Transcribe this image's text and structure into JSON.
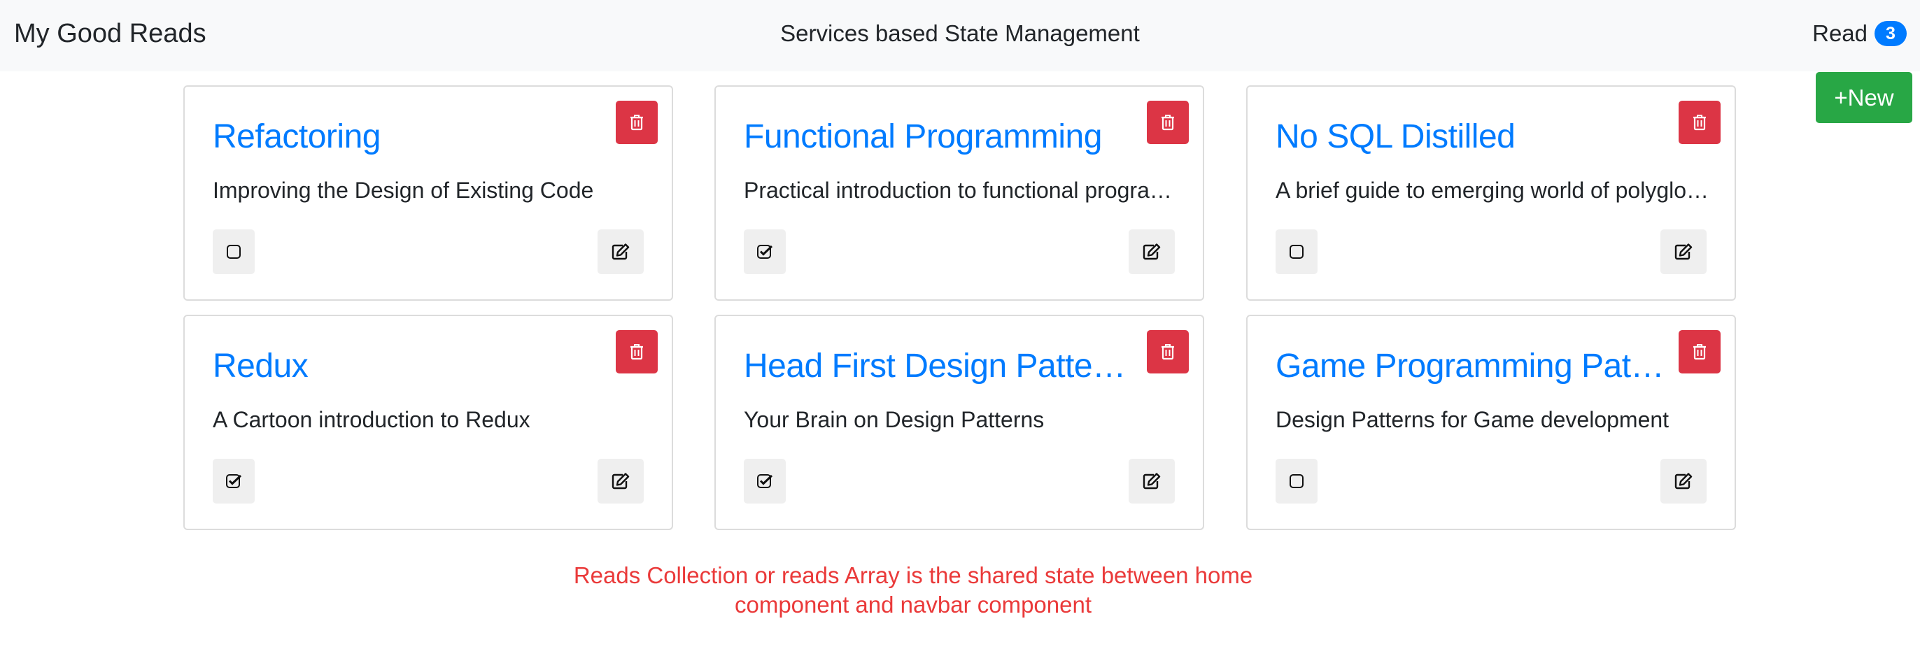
{
  "navbar": {
    "brand": "My Good Reads",
    "title": "Services based State Management",
    "read_label": "Read",
    "read_count": "3"
  },
  "new_button_label": "+New",
  "books": [
    {
      "title": "Refactoring",
      "subtitle": "Improving the Design of Existing Code",
      "read": false
    },
    {
      "title": "Functional Programming",
      "subtitle": "Practical introduction to functional programming",
      "read": true
    },
    {
      "title": "No SQL Distilled",
      "subtitle": "A brief guide to emerging world of polyglot persistence",
      "read": false
    },
    {
      "title": "Redux",
      "subtitle": "A Cartoon introduction to Redux",
      "read": true
    },
    {
      "title": "Head First Design Patterns",
      "subtitle": "Your Brain on Design Patterns",
      "read": true
    },
    {
      "title": "Game Programming Patterns",
      "subtitle": "Design Patterns for Game development",
      "read": false
    }
  ],
  "footer_note": {
    "line1": "Reads Collection or reads Array is the shared state between home",
    "line2": "component and navbar component"
  },
  "colors": {
    "primary": "#007bff",
    "danger": "#dc3545",
    "success": "#28a745",
    "note": "#ea3a3a"
  }
}
